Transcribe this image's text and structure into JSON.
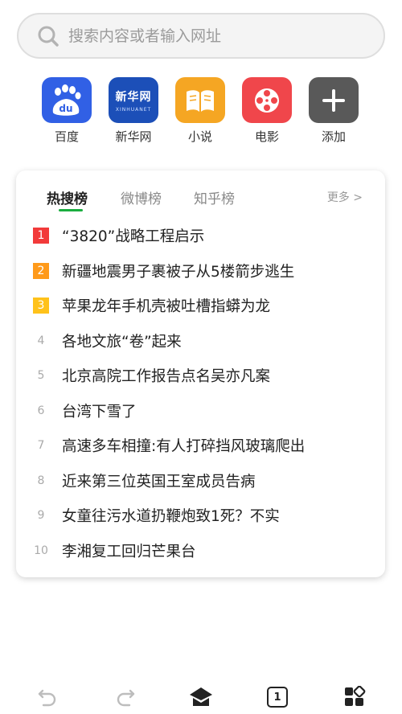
{
  "search": {
    "placeholder": "搜索内容或者输入网址",
    "value": ""
  },
  "shortcuts": [
    {
      "label": "百度",
      "icon": "baidu-icon",
      "color": "#3160e5"
    },
    {
      "label": "新华网",
      "icon": "xinhua-icon",
      "color": "#1c4fb8",
      "logo_text": "新华网",
      "logo_sub": "XINHUANET"
    },
    {
      "label": "小说",
      "icon": "book-icon",
      "color": "#f5a623"
    },
    {
      "label": "电影",
      "icon": "film-reel-icon",
      "color": "#f0464b"
    },
    {
      "label": "添加",
      "icon": "plus-icon",
      "color": "#595959"
    }
  ],
  "hot": {
    "tabs": [
      "热搜榜",
      "微博榜",
      "知乎榜"
    ],
    "active_tab": 0,
    "more": "更多 >",
    "accent": "#1aad3f",
    "items": [
      {
        "rank": "1",
        "title": "“3820”战略工程启示"
      },
      {
        "rank": "2",
        "title": "新疆地震男子裹被子从5楼箭步逃生"
      },
      {
        "rank": "3",
        "title": "苹果龙年手机壳被吐槽指蟒为龙"
      },
      {
        "rank": "4",
        "title": "各地文旅“卷”起来"
      },
      {
        "rank": "5",
        "title": "北京高院工作报告点名吴亦凡案"
      },
      {
        "rank": "6",
        "title": "台湾下雪了"
      },
      {
        "rank": "7",
        "title": "高速多车相撞:有人打碎挡风玻璃爬出"
      },
      {
        "rank": "8",
        "title": "近来第三位英国王室成员告病"
      },
      {
        "rank": "9",
        "title": "女童往污水道扔鞭炮致1死？不实"
      },
      {
        "rank": "10",
        "title": "李湘复工回归芒果台"
      }
    ]
  },
  "bottom": {
    "tab_count": "1",
    "icons": [
      "back-icon",
      "forward-icon",
      "home-icon",
      "tabs-icon",
      "menu-grid-icon"
    ]
  }
}
